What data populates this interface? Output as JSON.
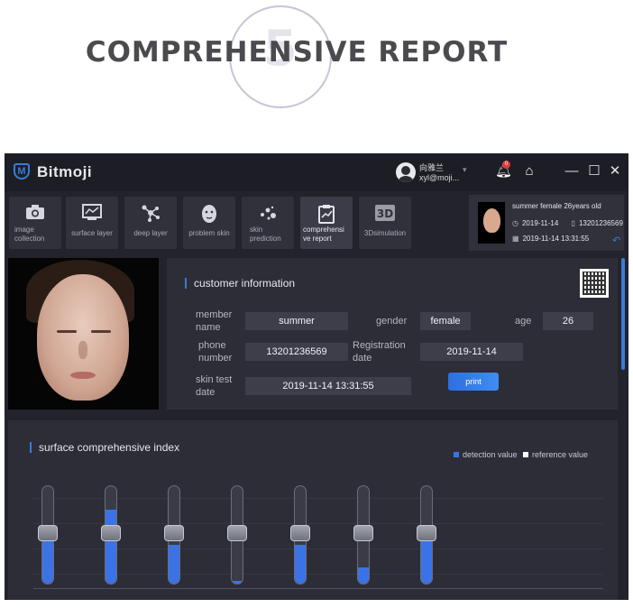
{
  "hero": {
    "number": "5",
    "title": "COMPREHENSIVE REPORT"
  },
  "app": {
    "brand": "Bitmoji",
    "user": {
      "name": "向雅兰",
      "email": "xyl@moji..."
    },
    "notifications": {
      "count": "0"
    },
    "tabs": [
      {
        "label": "image collection",
        "icon": "camera-icon"
      },
      {
        "label": "surface layer",
        "icon": "surface-chart-icon"
      },
      {
        "label": "deep layer",
        "icon": "molecule-icon"
      },
      {
        "label": "problem skin",
        "icon": "face-icon"
      },
      {
        "label": "skin prediction",
        "icon": "dots-icon"
      },
      {
        "label": "comprehensi ve report",
        "icon": "report-icon",
        "active": true
      },
      {
        "label": "3Dsimulation",
        "icon": "3d-icon"
      }
    ],
    "profile": {
      "line1": "summer   female   26years old",
      "date": "2019-11-14",
      "phone": "13201236569",
      "datetime": "2019-11-14 13:31:55"
    }
  },
  "customer": {
    "title": "customer information",
    "member_name_label": "member name",
    "member_name": "summer",
    "gender_label": "gender",
    "gender": "female",
    "age_label": "age",
    "age": "26",
    "phone_label": "phone number",
    "phone": "13201236569",
    "registration_label": "Registration date",
    "registration_date": "2019-11-14",
    "skin_test_label": "skin test date",
    "skin_test_date": "2019-11-14 13:31:55",
    "print_label": "print"
  },
  "index": {
    "title": "surface comprehensive index",
    "legend_detection": "detection value",
    "legend_reference": "reference value",
    "colors": {
      "detection": "#3b73e6",
      "reference": "#ffffff"
    },
    "detection_levels": [
      0.52,
      0.76,
      0.4,
      0.03,
      0.4,
      0.17,
      0.58
    ],
    "reference_levels": [
      0.52,
      0.52,
      0.52,
      0.52,
      0.52,
      0.52,
      0.52
    ]
  }
}
